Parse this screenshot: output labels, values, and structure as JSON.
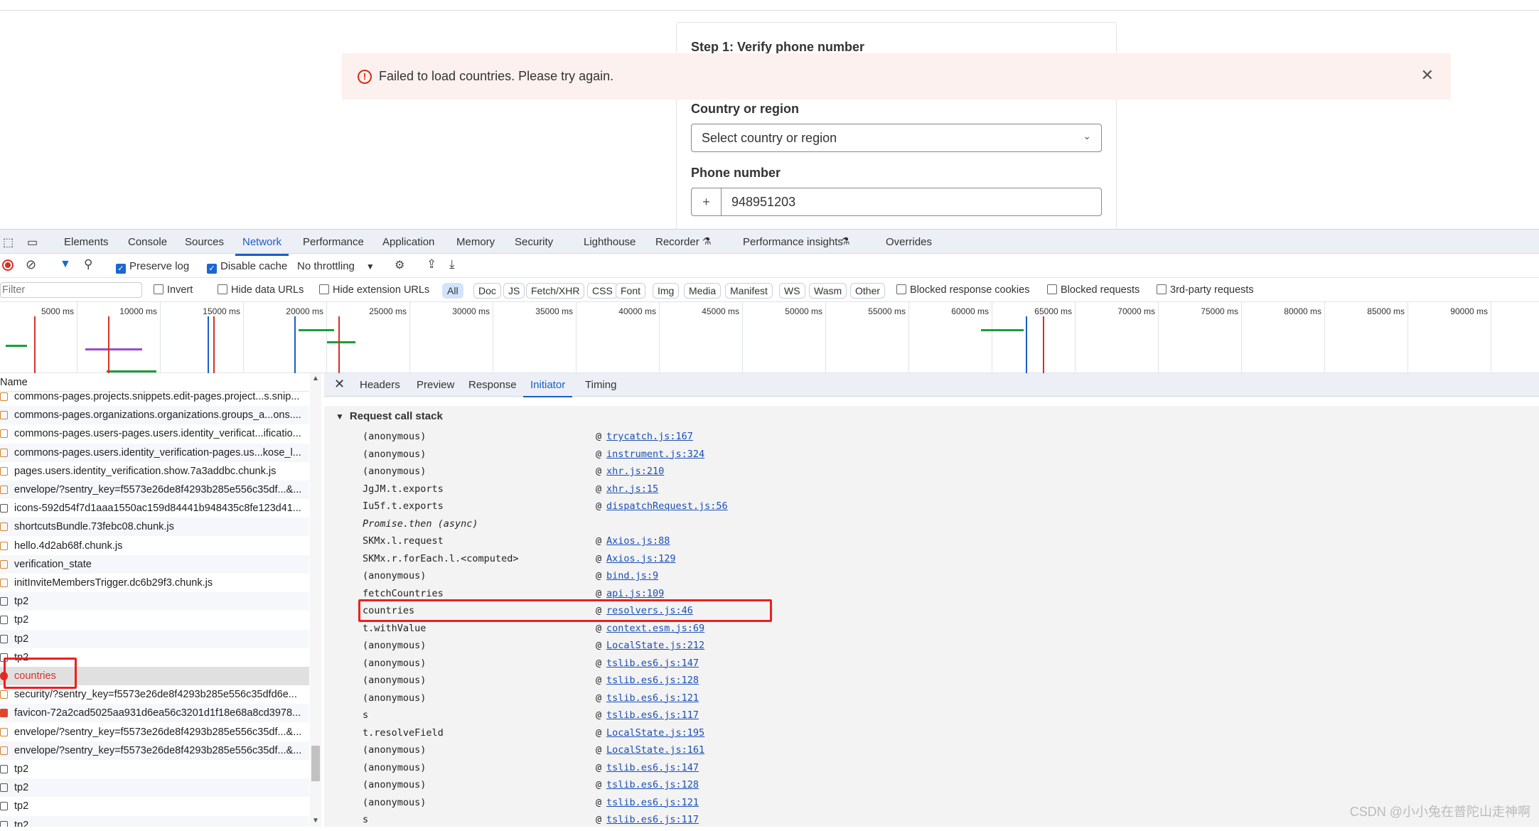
{
  "page": {
    "step_title": "Step 1: Verify phone number",
    "alert": "Failed to load countries. Please try again.",
    "country_label": "Country or region",
    "country_placeholder": "Select country or region",
    "phone_label": "Phone number",
    "phone_prefix": "+",
    "phone_value": "948951203"
  },
  "devtools": {
    "tabs": [
      "Elements",
      "Console",
      "Sources",
      "Network",
      "Performance",
      "Application",
      "Memory",
      "Security",
      "Lighthouse",
      "Recorder",
      "Performance insights",
      "Overrides"
    ],
    "active_tab": "Network",
    "toolbar": {
      "preserve_log": "Preserve log",
      "preserve_log_checked": true,
      "disable_cache": "Disable cache",
      "disable_cache_checked": true,
      "throttling": "No throttling"
    },
    "filter": {
      "placeholder": "Filter",
      "invert": "Invert",
      "hide_data_urls": "Hide data URLs",
      "hide_extension_urls": "Hide extension URLs",
      "types": [
        "All",
        "Doc",
        "JS",
        "Fetch/XHR",
        "CSS",
        "Font",
        "Img",
        "Media",
        "Manifest",
        "WS",
        "Wasm",
        "Other"
      ],
      "active_type": "All",
      "blocked_cookies": "Blocked response cookies",
      "blocked_requests": "Blocked requests",
      "third_party": "3rd-party requests"
    },
    "overview_ticks": [
      "5000 ms",
      "10000 ms",
      "15000 ms",
      "20000 ms",
      "25000 ms",
      "30000 ms",
      "35000 ms",
      "40000 ms",
      "45000 ms",
      "50000 ms",
      "55000 ms",
      "60000 ms",
      "65000 ms",
      "70000 ms",
      "75000 ms",
      "80000 ms",
      "85000 ms",
      "90000 ms"
    ],
    "name_header": "Name",
    "requests": [
      {
        "name": "commons-pages.projects.snippets.edit-pages.project...s.snip...",
        "type": "js"
      },
      {
        "name": "commons-pages.organizations.organizations.groups_a...ons....",
        "type": "js"
      },
      {
        "name": "commons-pages.users-pages.users.identity_verificat...ificatio...",
        "type": "js"
      },
      {
        "name": "commons-pages.users.identity_verification-pages.us...kose_l...",
        "type": "js"
      },
      {
        "name": "pages.users.identity_verification.show.7a3addbc.chunk.js",
        "type": "js"
      },
      {
        "name": "envelope/?sentry_key=f5573e26de8f4293b285e556c35df...&...",
        "type": "fetch"
      },
      {
        "name": "icons-592d54f7d1aaa1550ac159d84441b948435c8fe123d41...",
        "type": "img"
      },
      {
        "name": "shortcutsBundle.73febc08.chunk.js",
        "type": "js"
      },
      {
        "name": "hello.4d2ab68f.chunk.js",
        "type": "js"
      },
      {
        "name": "verification_state",
        "type": "fetch"
      },
      {
        "name": "initInviteMembersTrigger.dc6b29f3.chunk.js",
        "type": "js"
      },
      {
        "name": "tp2",
        "type": "doc"
      },
      {
        "name": "tp2",
        "type": "doc"
      },
      {
        "name": "tp2",
        "type": "doc"
      },
      {
        "name": "tp2",
        "type": "doc"
      },
      {
        "name": "countries",
        "type": "error",
        "selected": true
      },
      {
        "name": "security/?sentry_key=f5573e26de8f4293b285e556c35dfd6e...",
        "type": "js"
      },
      {
        "name": "favicon-72a2cad5025aa931d6ea56c3201d1f18e68a8cd3978...",
        "type": "favicon"
      },
      {
        "name": "envelope/?sentry_key=f5573e26de8f4293b285e556c35df...&...",
        "type": "fetch"
      },
      {
        "name": "envelope/?sentry_key=f5573e26de8f4293b285e556c35df...&...",
        "type": "fetch"
      },
      {
        "name": "tp2",
        "type": "doc"
      },
      {
        "name": "tp2",
        "type": "doc"
      },
      {
        "name": "tp2",
        "type": "doc"
      },
      {
        "name": "tp2",
        "type": "doc"
      }
    ],
    "detail_tabs": [
      "Headers",
      "Preview",
      "Response",
      "Initiator",
      "Timing"
    ],
    "active_detail_tab": "Initiator",
    "call_stack_title": "Request call stack",
    "call_stack": [
      {
        "fn": "(anonymous)",
        "src": "trycatch.js:167"
      },
      {
        "fn": "(anonymous)",
        "src": "instrument.js:324"
      },
      {
        "fn": "(anonymous)",
        "src": "xhr.js:210"
      },
      {
        "fn": "JgJM.t.exports",
        "src": "xhr.js:15"
      },
      {
        "fn": "Iu5f.t.exports",
        "src": "dispatchRequest.js:56"
      },
      {
        "fn": "Promise.then (async)",
        "src": "",
        "async": true
      },
      {
        "fn": "SKMx.l.request",
        "src": "Axios.js:88"
      },
      {
        "fn": "SKMx.r.forEach.l.<computed>",
        "src": "Axios.js:129"
      },
      {
        "fn": "(anonymous)",
        "src": "bind.js:9"
      },
      {
        "fn": "fetchCountries",
        "src": "api.js:109"
      },
      {
        "fn": "countries",
        "src": "resolvers.js:46",
        "highlighted": true
      },
      {
        "fn": "t.withValue",
        "src": "context.esm.js:69"
      },
      {
        "fn": "(anonymous)",
        "src": "LocalState.js:212"
      },
      {
        "fn": "(anonymous)",
        "src": "tslib.es6.js:147"
      },
      {
        "fn": "(anonymous)",
        "src": "tslib.es6.js:128"
      },
      {
        "fn": "(anonymous)",
        "src": "tslib.es6.js:121"
      },
      {
        "fn": "s",
        "src": "tslib.es6.js:117"
      },
      {
        "fn": "t.resolveField",
        "src": "LocalState.js:195"
      },
      {
        "fn": "(anonymous)",
        "src": "LocalState.js:161"
      },
      {
        "fn": "(anonymous)",
        "src": "tslib.es6.js:147"
      },
      {
        "fn": "(anonymous)",
        "src": "tslib.es6.js:128"
      },
      {
        "fn": "(anonymous)",
        "src": "tslib.es6.js:121"
      },
      {
        "fn": "s",
        "src": "tslib.es6.js:117"
      }
    ]
  },
  "watermark": "CSDN @小小兔在普陀山走神啊",
  "colors": {
    "accent": "#1a5fc8",
    "error": "#d93025",
    "annotation": "#f01e1e"
  }
}
